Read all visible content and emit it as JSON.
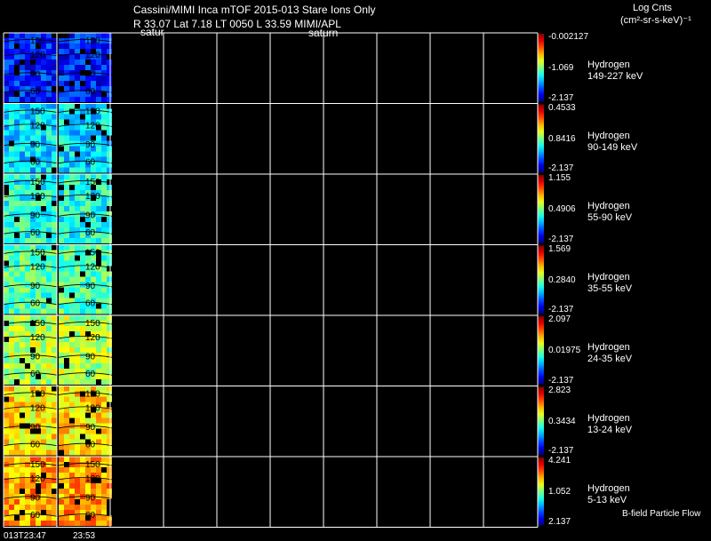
{
  "header": {
    "title": "Cassini/MIMI Inca mTOF  2015-013    Stare    Ions Only",
    "subtitle": "R       33.07 Lat 7.18 LT 0050 L        33.59  MIMI/APL",
    "sat_label_1": "satur",
    "sat_label_2": "saturn"
  },
  "units": {
    "label": "Log Cnts",
    "sub": "(cm²-sr-s-keV)⁻¹"
  },
  "time_labels": [
    "013T23:47",
    "23:53"
  ],
  "bfield_label": "B-field Particle Flow",
  "angle_labels": [
    "150",
    "120",
    "90",
    "60"
  ],
  "channels": [
    {
      "name": "Hydrogen",
      "range": "149-227 keV",
      "max": "-0.002127",
      "mid": "-1.069",
      "min": "-2.137",
      "level": 0.15
    },
    {
      "name": "Hydrogen",
      "range": "90-149 keV",
      "max": "0.4533",
      "mid": "0.8416",
      "min": "-2.137",
      "level": 0.35
    },
    {
      "name": "Hydrogen",
      "range": "55-90 keV",
      "max": "1.155",
      "mid": "0.4906",
      "min": "-2.137",
      "level": 0.4
    },
    {
      "name": "Hydrogen",
      "range": "35-55 keV",
      "max": "1.569",
      "mid": "0.2840",
      "min": "-2.137",
      "level": 0.45
    },
    {
      "name": "Hydrogen",
      "range": "24-35 keV",
      "max": "2.097",
      "mid": "0.01975",
      "min": "-2.137",
      "level": 0.55
    },
    {
      "name": "Hydrogen",
      "range": "13-24 keV",
      "max": "2.823",
      "mid": "0.3434",
      "min": "-2.137",
      "level": 0.65
    },
    {
      "name": "Hydrogen",
      "range": "5-13 keV",
      "max": "4.241",
      "mid": "1.052",
      "min": "2.137",
      "level": 0.72
    }
  ],
  "colors": {
    "background": "#000000",
    "grid": "#ffffff",
    "colorbar_top": "#ff0000",
    "colorbar_bottom": "#0000ff"
  }
}
